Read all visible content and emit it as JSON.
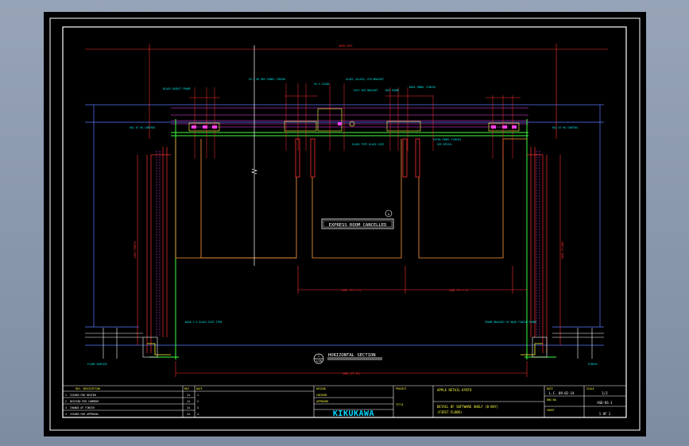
{
  "colors": {
    "viewport_bg": "#8a98ac",
    "sheet_bg": "#000000",
    "frame": "#ffffff",
    "outline": "#ff3030",
    "partition": "#ff9a3c",
    "trim": "#ff40ff",
    "floor": "#40ff40",
    "label": "#00e5e5",
    "note": "#ffff40",
    "logo": "#00d8ff"
  },
  "drawing": {
    "title_bubble": "EXPRESS ROOM CANCELLED",
    "title_bubble_num": "A",
    "section_title": "HORIZONTAL SECTION",
    "section_ref": "1",
    "section_scale": "1/20",
    "dim_top": "9050 SPEC",
    "dim_bottom": "7800 (PT.AC)",
    "dim_left": "2400 FINISH",
    "dim_right": "3400 (FLOOR)",
    "dim_seg1": "2400 (PT.C-1)",
    "dim_seg2": "2400 (PT.C-2)",
    "notes_top": [
      "BLACK GASKET FRAME",
      "SS-3 WT\nBUS PANEL FINISH",
      "SS-3\nCLEAR",
      "GLASS (GLASS)\nSTD BRACKET",
      "ASIC\nSUS BRACKET",
      "BUS FRAME",
      "BASE PANEL FINISH"
    ],
    "notes_mid": [
      "GLASS TYPE\nGLASS SIZE",
      "EXTRA PANEL FINISH",
      "SEE DETAIL"
    ],
    "notes_bottom": [
      "BASE-3 A\nGLASS SIZE ITEM",
      "FRAME BRACKET-SS\nBASE FINISH FRAME",
      "FLOOR SURFACE",
      "FINISH"
    ],
    "label_left": "HG1 AT\nHG CONTROL",
    "label_right": "HG2 AT\nHG CONTROL"
  },
  "title_block": {
    "revisions": [
      {
        "mark": "1",
        "desc": "ISSUED FOR REVIEW",
        "date": "14",
        "by": "1"
      },
      {
        "mark": "2",
        "desc": "REVISED PER COMMENT",
        "date": "14",
        "by": "2"
      },
      {
        "mark": "3",
        "desc": "CHANGE OF FINISH",
        "date": "14",
        "by": "3"
      },
      {
        "mark": "4",
        "desc": "ISSUED FOR APPROVAL",
        "date": "14",
        "by": "4"
      }
    ],
    "rev_header": "REV. DESCRIPTION",
    "col_rev": "REV",
    "col_date": "DATE",
    "designed": "DESIGN",
    "checked": "CHECKED",
    "approved": "APPROVED",
    "company": "KIKUKAWA",
    "project_label": "PROJECT",
    "project": "APPLE RETAIL KYOTO",
    "subtitle_label": "TITLE",
    "title_line1": "DETAIL OF SOFTWARE SHELF (B-BAY)",
    "title_line2": "(FIRST FLOOR)",
    "scale_label": "SCALE",
    "scale": "1/2",
    "date_label": "DATE",
    "date": "L.C. 09-02-14",
    "dwg_label": "DWG NO.",
    "dwg_no": "ASD-DS-1",
    "sheet_label": "SHEET",
    "sheet": "1 OF 1"
  }
}
